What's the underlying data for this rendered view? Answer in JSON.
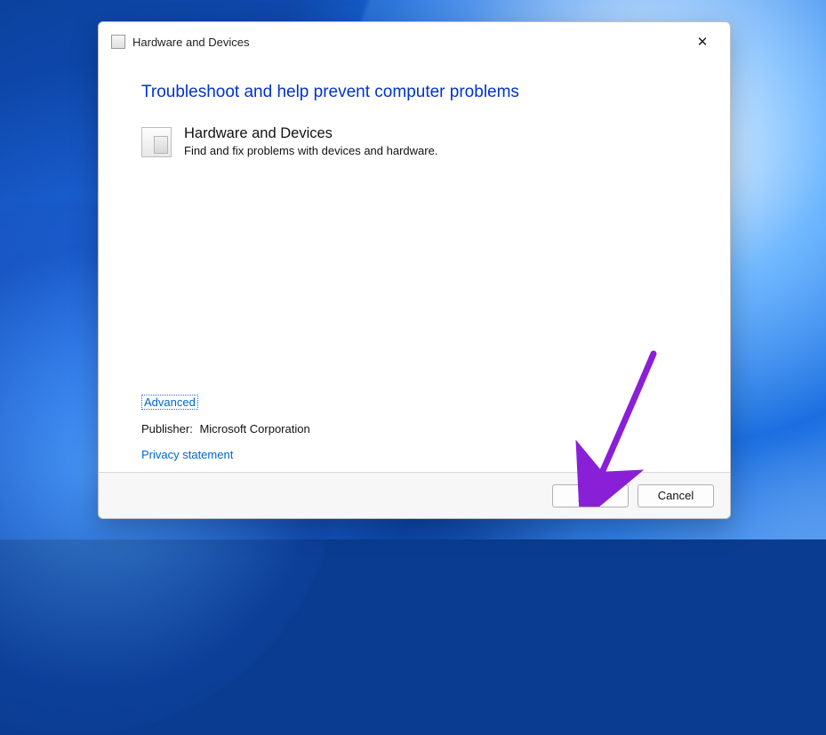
{
  "titlebar": {
    "title": "Hardware and Devices"
  },
  "content": {
    "heading": "Troubleshoot and help prevent computer problems",
    "item_title": "Hardware and Devices",
    "item_desc": "Find and fix problems with devices and hardware.",
    "advanced_link": "Advanced",
    "publisher_label": "Publisher:",
    "publisher_value": "Microsoft Corporation",
    "privacy_link": "Privacy statement"
  },
  "buttons": {
    "next_prefix": "N",
    "next_rest": "ext",
    "cancel": "Cancel"
  }
}
